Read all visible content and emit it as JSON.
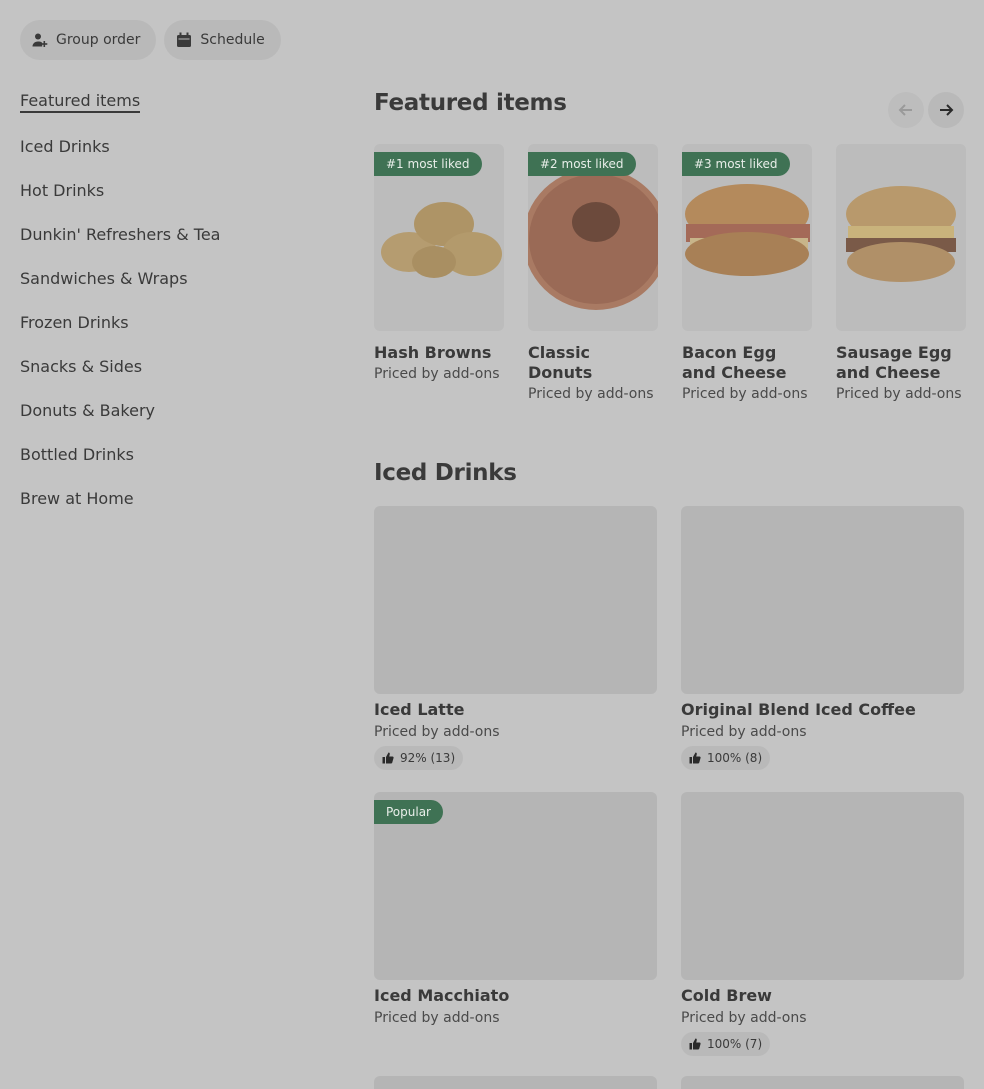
{
  "topbar": {
    "group_order": "Group order",
    "schedule": "Schedule"
  },
  "sidebar": {
    "items": [
      {
        "label": "Featured items"
      },
      {
        "label": "Iced Drinks"
      },
      {
        "label": "Hot Drinks"
      },
      {
        "label": "Dunkin' Refreshers & Tea"
      },
      {
        "label": "Sandwiches & Wraps"
      },
      {
        "label": "Frozen Drinks"
      },
      {
        "label": "Snacks & Sides"
      },
      {
        "label": "Donuts & Bakery"
      },
      {
        "label": "Bottled Drinks"
      },
      {
        "label": "Brew at Home"
      }
    ]
  },
  "featured": {
    "title": "Featured items",
    "items": [
      {
        "badge": "#1 most liked",
        "name": "Hash Browns",
        "price": "Priced by add-ons"
      },
      {
        "badge": "#2 most liked",
        "name": "Classic Donuts",
        "price": "Priced by add-ons"
      },
      {
        "badge": "#3 most liked",
        "name": "Bacon Egg and Cheese",
        "price": "Priced by add-ons"
      },
      {
        "name": "Sausage Egg and Cheese",
        "price": "Priced by add-ons"
      }
    ]
  },
  "iced": {
    "title": "Iced Drinks",
    "items": [
      {
        "name": "Iced Latte",
        "price": "Priced by add-ons",
        "rating": "92% (13)"
      },
      {
        "name": "Original Blend Iced Coffee",
        "price": "Priced by add-ons",
        "rating": "100% (8)"
      },
      {
        "badge": "Popular",
        "name": "Iced Macchiato",
        "price": "Priced by add-ons"
      },
      {
        "name": "Cold Brew",
        "price": "Priced by add-ons",
        "rating": "100% (7)"
      }
    ]
  },
  "colors": {
    "badge_green": "#3f7254",
    "background": "#c4c4c4"
  }
}
